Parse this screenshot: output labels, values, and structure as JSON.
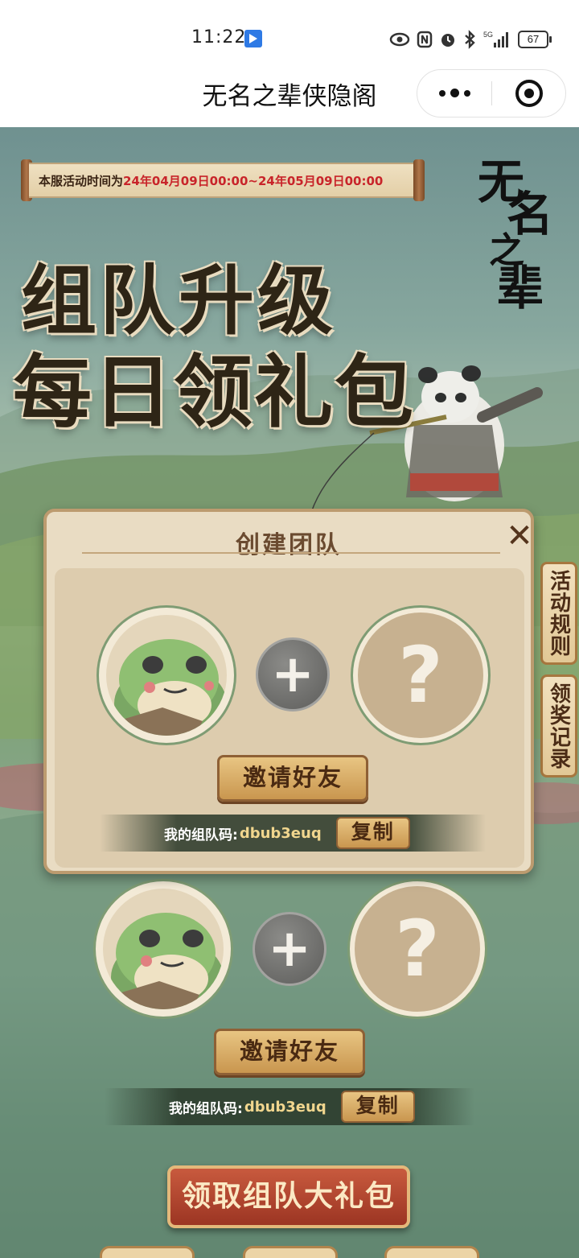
{
  "status_bar": {
    "time": "11:22",
    "icons": [
      "share-icon",
      "eye-icon",
      "nfc-icon",
      "alarm-icon",
      "bluetooth-icon",
      "signal-5g-icon"
    ],
    "battery": "67"
  },
  "navbar": {
    "title": "无名之辈侠隐阁",
    "capsule": [
      "more-icon",
      "close-icon"
    ]
  },
  "event": {
    "time_label": "本服活动时间为",
    "time_range": "24年04月09日00:00~24年05月09日00:00",
    "logo_chars": [
      "无",
      "名",
      "之",
      "辈"
    ],
    "hero_line1": "组队升级",
    "hero_line2": "每日领礼包"
  },
  "side_tabs": {
    "rules": "活动规则",
    "records": "领奖记录"
  },
  "panel": {
    "title": "创建团队",
    "close": "✕",
    "plus": "+",
    "unknown": "?",
    "invite_label": "邀请好友",
    "code_label": "我的组队码:",
    "code_value": "dbub3euq",
    "copy_label": "复制"
  },
  "team_behind": {
    "plus": "+",
    "unknown": "?",
    "invite_label": "邀请好友",
    "code_label": "我的组队码:",
    "code_value": "dbub3euq",
    "copy_label": "复制"
  },
  "claim": {
    "label": "领取组队大礼包"
  },
  "colors": {
    "accent_red": "#c8242a",
    "panel_bg": "#e9dcc3",
    "button_gold": "#c9964f",
    "claim_red": "#9c3523"
  }
}
